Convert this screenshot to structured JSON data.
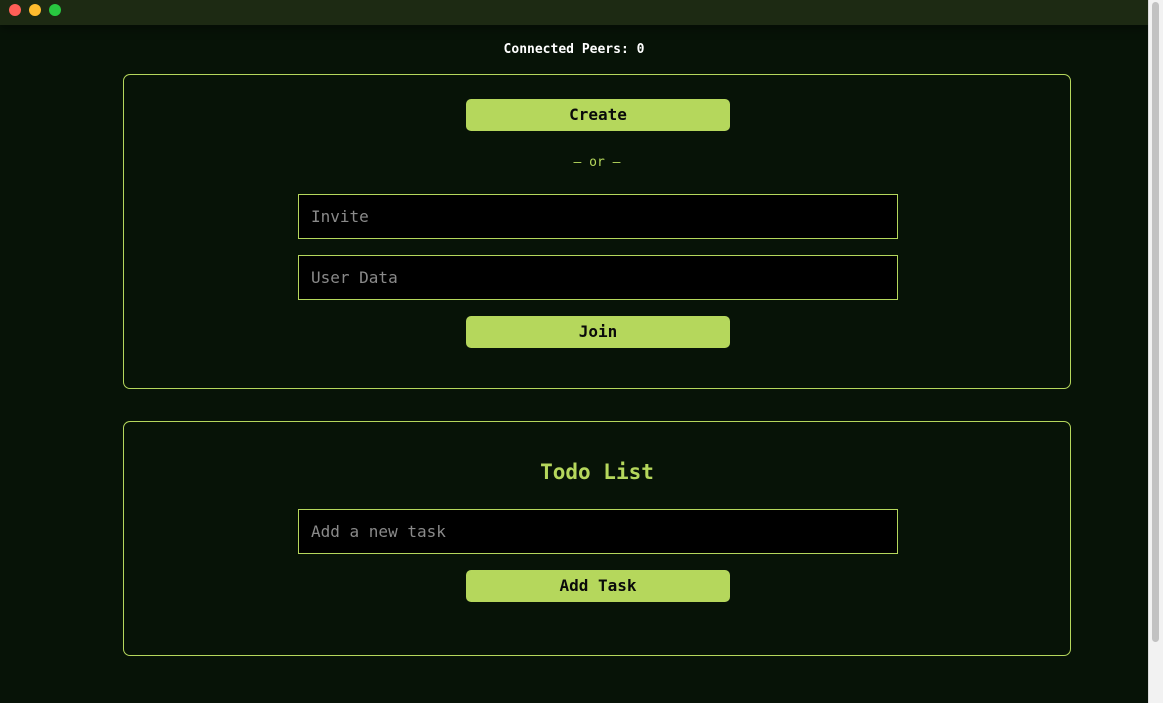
{
  "window": {
    "traffic_lights": [
      "close",
      "minimize",
      "maximize"
    ]
  },
  "header": {
    "peers_label": "Connected Peers: 0"
  },
  "session": {
    "create_label": "Create",
    "or_label": "— or —",
    "invite_placeholder": "Invite",
    "userdata_placeholder": "User Data",
    "join_label": "Join"
  },
  "todo": {
    "title": "Todo List",
    "task_placeholder": "Add a new task",
    "add_label": "Add Task"
  },
  "colors": {
    "background": "#071307",
    "accent": "#b5d75c",
    "input_bg": "#000000"
  }
}
